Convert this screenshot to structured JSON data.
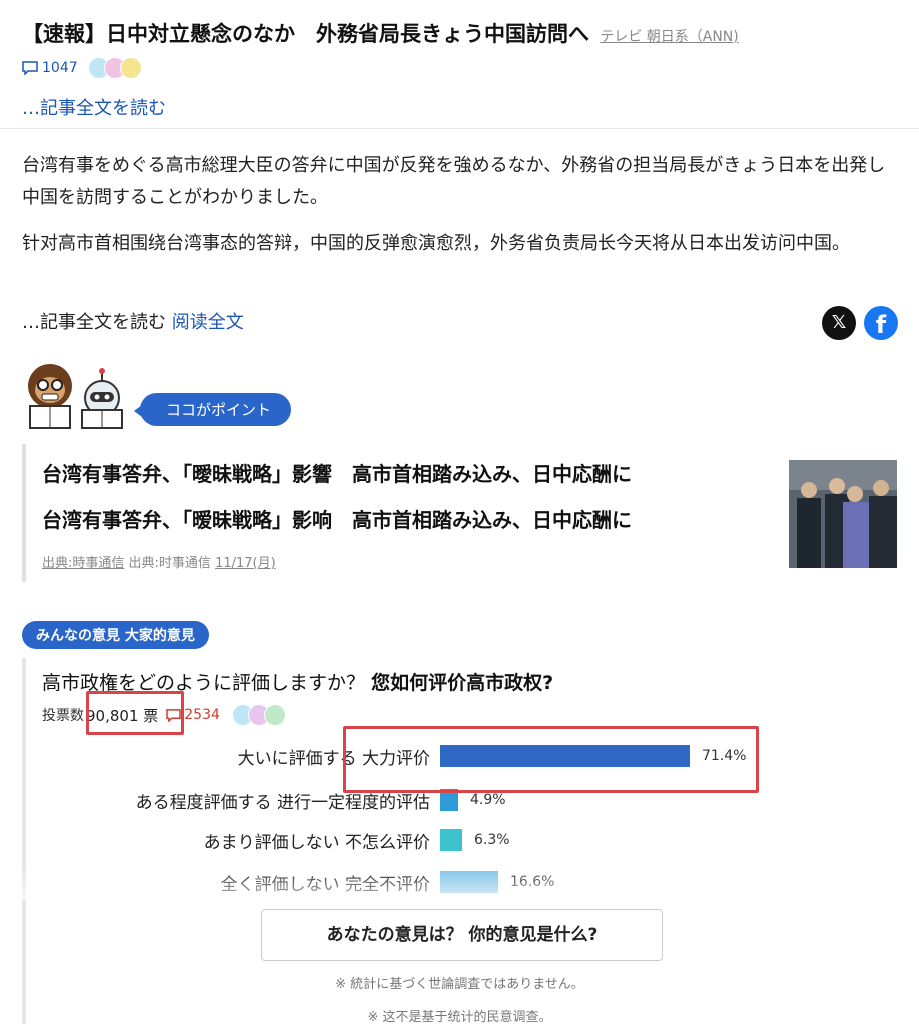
{
  "article": {
    "headline": "【速報】日中対立懸念のなか　外務省局長きょう中国訪問へ",
    "source": "テレビ 朝日系（ANN)",
    "comment_count": "1047",
    "read_more_top": "…記事全文を読む",
    "para_jp": "台湾有事をめぐる高市総理大臣の答弁に中国が反発を強めるなか、外務省の担当局長がきょう日本を出発し中国を訪問することがわかりました。",
    "para_cn": "针对高市首相围绕台湾事态的答辩，中国的反弹愈演愈烈，外务省负责局长今天将从日本出发访问中国。",
    "read_more_jp": "…記事全文を読む",
    "read_more_cn": "阅读全文",
    "colors": {
      "accent": "#2a66c9",
      "link": "#1a56b8"
    }
  },
  "share": {
    "x_icon": "x-icon",
    "facebook_icon": "facebook-icon"
  },
  "point": {
    "badge": "ココがポイント",
    "title_jp": "台湾有事答弁、「曖昧戦略」影響　高市首相踏み込み、日中応酬に",
    "title_cn": "台湾有事答弁、「暧昧戦略」影响　高市首相踏み込み、日中応酬に",
    "source_jp": "出典:時事通信",
    "source_cn": "出典:时事通信",
    "date": "11/17(月)"
  },
  "poll": {
    "badge": "みんなの意見 大家的意見",
    "question_jp": "高市政権をどのように評価しますか？",
    "question_cn": "您如何评价高市政权?",
    "votes_label": "投票数",
    "votes_value": "90,801 票",
    "comment_count": "2534",
    "options": [
      {
        "label_jp": "大いに評価する",
        "label_cn": "大力评价",
        "value": 71.4,
        "pct": "71.4%",
        "color": "#2f69c4"
      },
      {
        "label_jp": "ある程度評価する",
        "label_cn": "进行一定程度的评估",
        "value": 4.9,
        "pct": "4.9%",
        "color": "#2c9bd8"
      },
      {
        "label_jp": "あまり評価しない",
        "label_cn": "不怎么评价",
        "value": 6.3,
        "pct": "6.3%",
        "color": "#3cc3cd"
      },
      {
        "label_jp": "全く評価しない",
        "label_cn": "完全不评价",
        "value": 16.6,
        "pct": "16.6%",
        "color": "#7fc3e8"
      }
    ],
    "button": "あなたの意見は？ 你的意见是什么?",
    "note_jp": "※ 統計に基づく世論調査ではありません。",
    "note_cn": "※ 这不是基于统计的民意调查。"
  }
}
